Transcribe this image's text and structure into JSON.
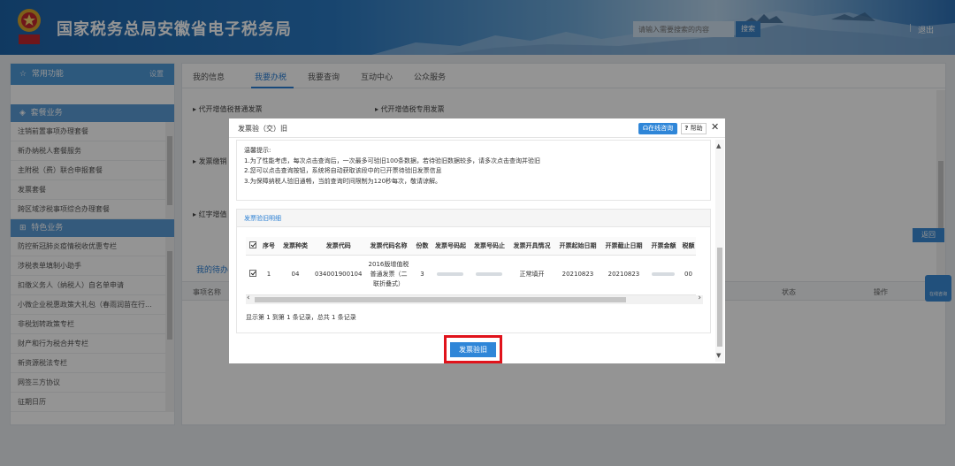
{
  "header": {
    "site_title": "国家税务总局安徽省电子税务局",
    "search_placeholder": "请输入需要搜索的内容",
    "search_button": "搜索",
    "logout_sep": "|",
    "logout": "退出"
  },
  "sidebar": {
    "common_title": "常用功能",
    "settings": "设置",
    "package_section": "套餐业务",
    "package_items": [
      "注销前置事项办理套餐",
      "新办纳税人套餐服务",
      "主附税（费）联合申报套餐",
      "发票套餐",
      "跨区域涉税事项综合办理套餐"
    ],
    "feature_section": "特色业务",
    "feature_items": [
      "防控新冠肺炎疫情税收优惠专栏",
      "涉税表单填制小助手",
      "扣缴义务人（纳税人）自名单申请",
      "小微企业税惠政策大礼包（春雨润苗在行...",
      "非税划转政策专栏",
      "财产和行为税合并专栏",
      "新资源税法专栏",
      "网签三方协议",
      "征期日历"
    ]
  },
  "main": {
    "tabs": [
      "我的信息",
      "我要办税",
      "我要查询",
      "互动中心",
      "公众服务"
    ],
    "active_tab": "我要办税",
    "links": {
      "general_invoice": "代开增值税普通发票",
      "special_invoice": "代开增值税专用发票",
      "invoice_cancel": "发票缴销",
      "red_invoice": "红字增值"
    },
    "back_button": "返回",
    "todo_title": "我的待办",
    "todo_cols": {
      "item_name": "事项名称",
      "status": "状态",
      "action": "操作"
    },
    "online_float": "在线咨询"
  },
  "modal": {
    "title": "发票验（交）旧",
    "online_consult": "在线咨询",
    "help": "帮助",
    "close": "✕",
    "tips_title": "温馨提示:",
    "tips": [
      "1.为了性能考虑，每次点击查询后，一次最多可验旧100条数据，若待验旧数据较多，请多次点击查询并验旧",
      "2.您可以点击查询按钮，系统将自动获取该段中的已开票待验旧发票信息",
      "3.为保障纳税人验旧通畅，当前查询时间限制为120秒每次，敬请谅解。"
    ],
    "detail_title": "发票验旧明细",
    "columns": [
      "序号",
      "发票种类",
      "发票代码",
      "发票代码名称",
      "份数",
      "发票号码起",
      "发票号码止",
      "发票开具情况",
      "开票起始日期",
      "开票截止日期",
      "开票金额",
      "税额"
    ],
    "rows": [
      {
        "index": "1",
        "kind": "04",
        "code": "034001900104",
        "code_name": [
          "2016版增值税",
          "普通发票（二",
          "联折叠式）"
        ],
        "count": "3",
        "status": "正常填开",
        "start_date": "20210823",
        "end_date": "20210823",
        "tax": "00"
      }
    ],
    "pager": "显示第 1 到第 1 条记录，总共 1 条记录",
    "verify_button": "发票验旧"
  }
}
